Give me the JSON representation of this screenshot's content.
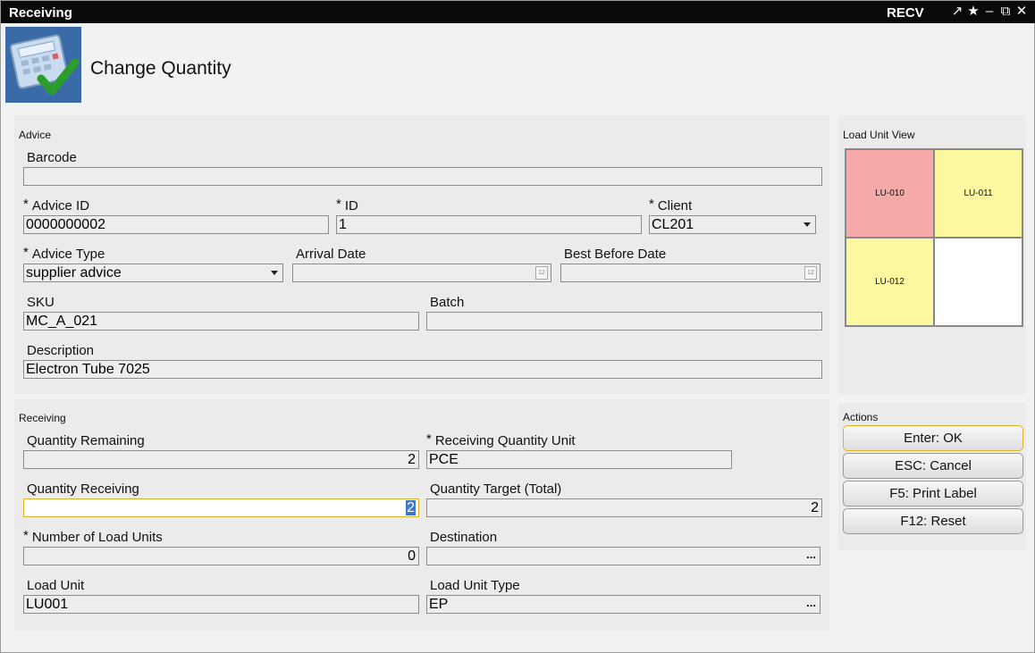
{
  "window": {
    "title": "Receiving",
    "code": "RECV",
    "icons": [
      "pin-icon",
      "star-icon",
      "minimize-icon",
      "restore-icon",
      "close-icon"
    ]
  },
  "page": {
    "title": "Change Quantity",
    "icon": "calculator-check-icon"
  },
  "advice": {
    "section_label": "Advice",
    "barcode": {
      "label": "Barcode",
      "value": ""
    },
    "advice_id": {
      "label": "Advice ID",
      "value": "0000000002",
      "required": true
    },
    "id": {
      "label": "ID",
      "value": "1",
      "required": true
    },
    "client": {
      "label": "Client",
      "value": "CL201",
      "required": true
    },
    "advice_type": {
      "label": "Advice Type",
      "value": "supplier advice",
      "required": true
    },
    "arrival_date": {
      "label": "Arrival Date",
      "value": "",
      "calendar_icon_text": "12"
    },
    "best_before_date": {
      "label": "Best Before Date",
      "value": "",
      "calendar_icon_text": "12"
    },
    "sku": {
      "label": "SKU",
      "value": "MC_A_021"
    },
    "batch": {
      "label": "Batch",
      "value": ""
    },
    "description": {
      "label": "Description",
      "value": "Electron Tube 7025"
    }
  },
  "receiving": {
    "section_label": "Receiving",
    "quantity_remaining": {
      "label": "Quantity Remaining",
      "value": "2"
    },
    "receiving_quantity_unit": {
      "label": "Receiving Quantity Unit",
      "value": "PCE",
      "required": true
    },
    "quantity_receiving": {
      "label": "Quantity Receiving",
      "value": "2"
    },
    "quantity_target": {
      "label": "Quantity Target (Total)",
      "value": "2"
    },
    "number_of_load_units": {
      "label": "Number of Load Units",
      "value": "0",
      "required": true
    },
    "destination": {
      "label": "Destination",
      "value": "",
      "button": "..."
    },
    "load_unit": {
      "label": "Load Unit",
      "value": "LU001"
    },
    "load_unit_type": {
      "label": "Load Unit Type",
      "value": "EP",
      "button": "..."
    }
  },
  "load_unit_view": {
    "section_label": "Load Unit View",
    "cells": [
      {
        "label": "LU-010",
        "color": "#f7a8a8"
      },
      {
        "label": "LU-011",
        "color": "#fbf8a0"
      },
      {
        "label": "LU-012",
        "color": "#fbf8a0"
      },
      {
        "label": "",
        "color": "#ffffff"
      }
    ]
  },
  "actions": {
    "section_label": "Actions",
    "buttons": [
      "Enter: OK",
      "ESC: Cancel",
      "F5: Print Label",
      "F12: Reset"
    ]
  },
  "colors": {
    "titlebar": "#0a0a0a",
    "focus_border": "#e1b12c",
    "selection": "#3a78c9"
  }
}
